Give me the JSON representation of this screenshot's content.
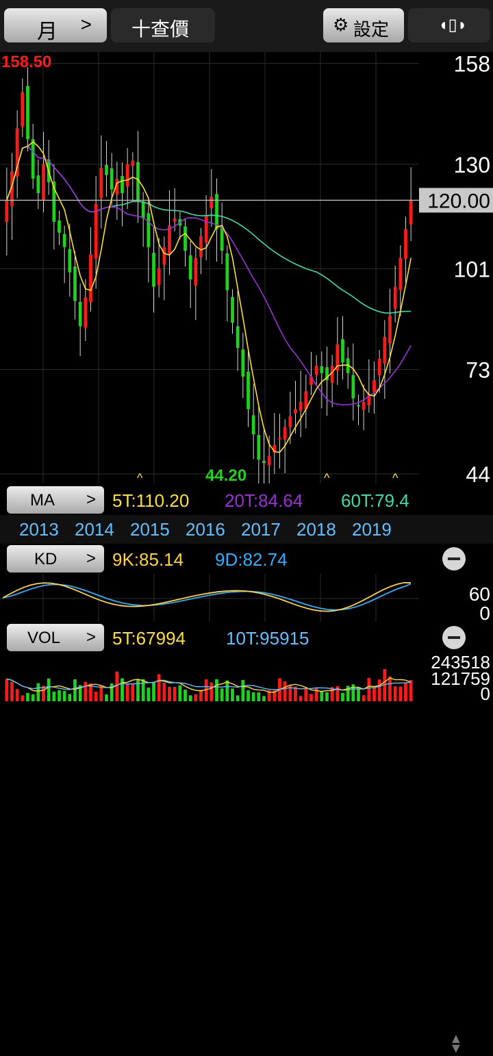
{
  "toolbar": {
    "period_label": "月",
    "period_chevron": ">",
    "query_label": "十查價",
    "settings_label": "設定",
    "settings_icon": "gear-icon",
    "rotate_icon": "rotate-icon",
    "rotate_glyph": "◖▯◗"
  },
  "price_panel": {
    "high_label": "158.50",
    "low_label": "44.20",
    "current_price": "120.00",
    "y_ticks": [
      "158",
      "130",
      "101",
      "73",
      "44"
    ]
  },
  "ma_row": {
    "button": "MA",
    "chevron": ">",
    "ma5": "5T:110.20",
    "ma20": "20T:84.64",
    "ma60": "60T:79.4"
  },
  "years": [
    "2013",
    "2014",
    "2015",
    "2016",
    "2017",
    "2018",
    "2019"
  ],
  "kd_row": {
    "button": "KD",
    "chevron": ">",
    "k": "9K:85.14",
    "d": "9D:82.74",
    "y_ticks": [
      "60",
      "0"
    ]
  },
  "vol_row": {
    "button": "VOL",
    "chevron": ">",
    "vol5": "5T:67994",
    "vol10": "10T:95915",
    "y_ticks": [
      "243518",
      "121759",
      "0"
    ]
  },
  "colors": {
    "up": "#ff1a1a",
    "down": "#1ed21e",
    "ma5": "#ffe02e",
    "ma20": "#9b30d9",
    "ma60": "#38e0a8",
    "kd_k": "#ffd23a",
    "kd_d": "#2ab0ff",
    "cyan": "#5fc0ff"
  },
  "chart_data": {
    "type": "candlestick",
    "timeframe": "monthly",
    "ylim": [
      44,
      158.5
    ],
    "y_ticks": [
      158,
      130,
      101,
      73,
      44
    ],
    "x_ticks": [
      "2013",
      "2014",
      "2015",
      "2016",
      "2017",
      "2018",
      "2019"
    ],
    "annotations": {
      "high": 158.5,
      "low": 44.2,
      "current": 120.0
    },
    "close": [
      120,
      128,
      140,
      150,
      137,
      126,
      122,
      130,
      125,
      114,
      111,
      107,
      100,
      92,
      85,
      93,
      105,
      119,
      129,
      127,
      123,
      126,
      122,
      130,
      131,
      120,
      115,
      107,
      96,
      101,
      107,
      113,
      115,
      113,
      106,
      98,
      104,
      110,
      116,
      121,
      112,
      106,
      95,
      86,
      79,
      71,
      62,
      55,
      48,
      47,
      49,
      52,
      54,
      57,
      60,
      62,
      64,
      67,
      71,
      74,
      72,
      70,
      74,
      80,
      75,
      72,
      65,
      63,
      64,
      66,
      70,
      76,
      82,
      88,
      96,
      104,
      112,
      120
    ],
    "ma5_last": 110.2,
    "ma20_last": 84.64,
    "ma60_last": 79.4,
    "kd": {
      "k_last": 85.14,
      "d_last": 82.74
    },
    "volume": {
      "ma5_last": 67994,
      "ma10_last": 95915,
      "ylim": [
        0,
        243518
      ]
    }
  }
}
